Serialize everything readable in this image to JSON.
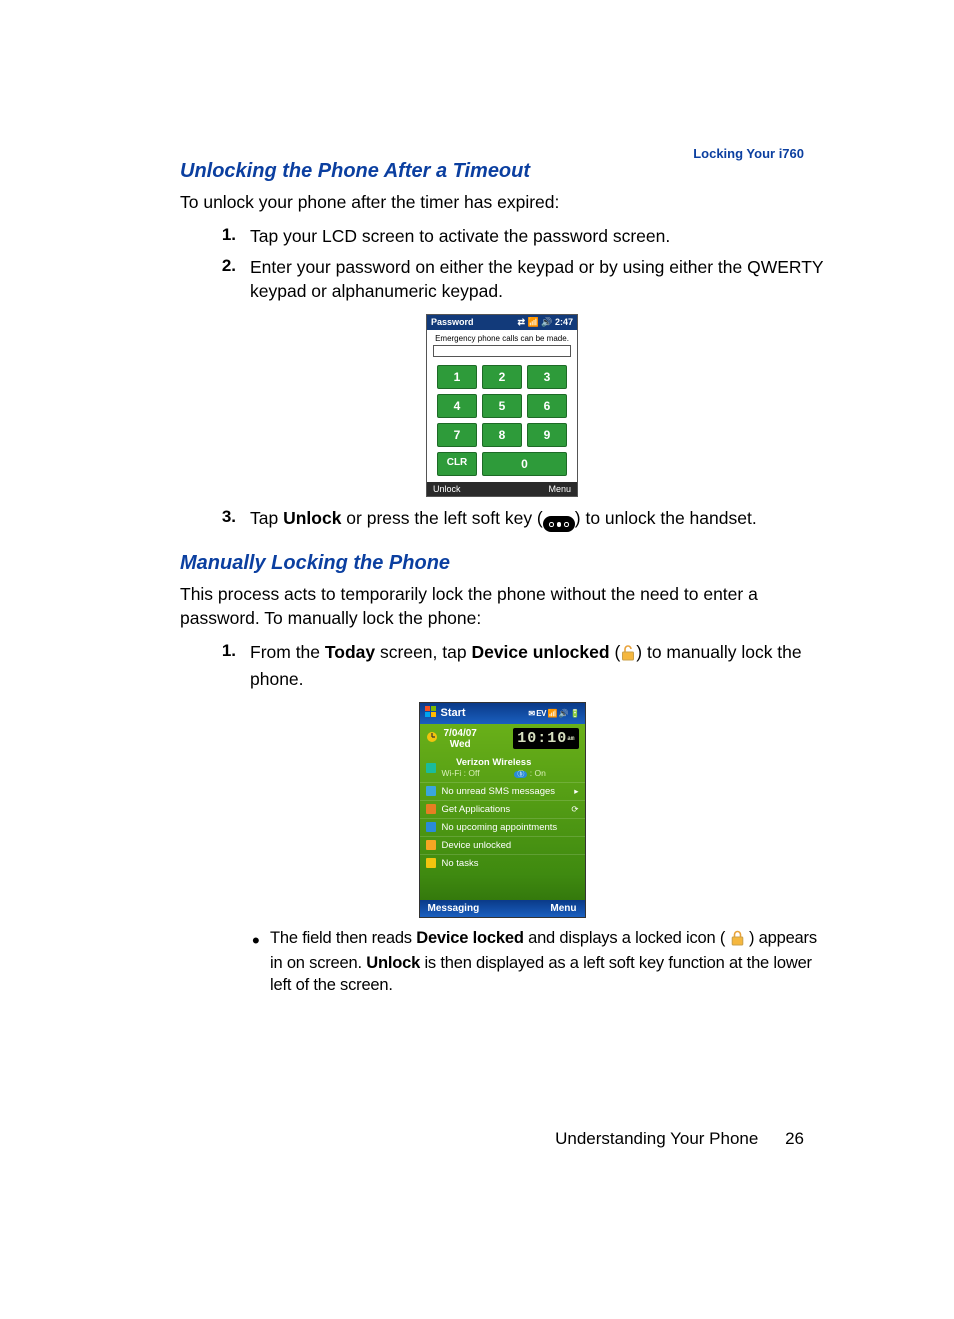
{
  "header_tag": "Locking Your i760",
  "section1": {
    "heading": "Unlocking the Phone After a Timeout",
    "intro": "To unlock your phone after the timer has expired:",
    "steps": [
      {
        "num": "1.",
        "text": "Tap your LCD screen to activate the password screen."
      },
      {
        "num": "2.",
        "text": "Enter your password on either the keypad or by using either the QWERTY keypad or alphanumeric keypad."
      },
      {
        "num": "3.",
        "pre": "Tap ",
        "bold1": "Unlock",
        "mid": " or press the left soft key (",
        "post": ") to unlock the handset."
      }
    ]
  },
  "password_screen": {
    "title": "Password",
    "status": "2:47",
    "msg": "Emergency phone calls can be made.",
    "keys": [
      "1",
      "2",
      "3",
      "4",
      "5",
      "6",
      "7",
      "8",
      "9",
      "CLR",
      "0"
    ],
    "left": "Unlock",
    "right": "Menu"
  },
  "section2": {
    "heading": "Manually Locking the Phone",
    "intro": "This process acts to temporarily lock the phone without the need to enter a password. To manually lock the phone:",
    "step": {
      "num": "1.",
      "pre": "From the ",
      "bold1": "Today",
      "mid1": " screen, tap ",
      "bold2": "Device unlocked",
      "mid2": " (",
      "post": ") to manually lock the phone."
    },
    "bullet": {
      "pre": "The field then reads ",
      "bold1": "Device locked",
      "mid1": " and displays a locked icon (",
      "mid2": ") appears in on screen. ",
      "bold2": "Unlock",
      "post": " is then displayed as a left soft key function at the lower left of the screen."
    }
  },
  "today_screen": {
    "start": "Start",
    "date_line1": "7/04/07",
    "date_line2": "Wed",
    "clock": "10:10",
    "clock_suffix": "am",
    "carrier": "Verizon Wireless",
    "wifi": "Wi-Fi : Off",
    "bt_label": "On",
    "sms": "No unread SMS messages",
    "apps": "Get Applications",
    "appts": "No upcoming appointments",
    "lock": "Device unlocked",
    "tasks": "No tasks",
    "left": "Messaging",
    "right": "Menu"
  },
  "footer": {
    "section": "Understanding Your Phone",
    "page": "26"
  }
}
